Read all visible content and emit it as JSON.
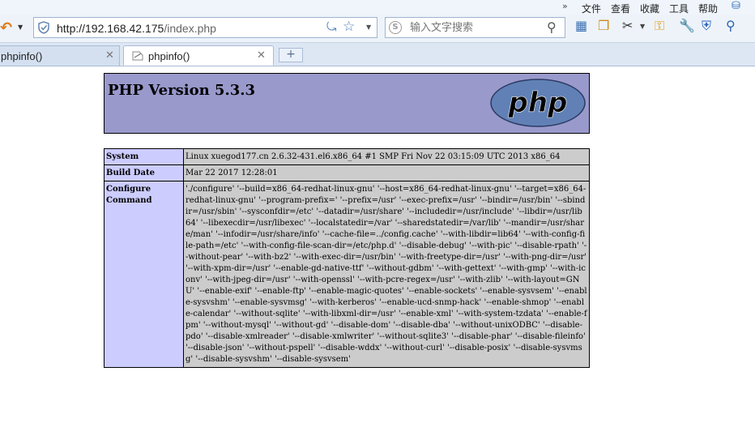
{
  "menu": {
    "chevron": "»",
    "file": "文件",
    "view": "查看",
    "favorites": "收藏",
    "tools": "工具",
    "help": "帮助"
  },
  "address_bar": {
    "url_host": "http://192.168.42.175",
    "url_path": "/index.php"
  },
  "search": {
    "placeholder": "输入文字搜索"
  },
  "toolbar_icons": [
    "calculator-icon",
    "tab-window-icon",
    "scissors-icon",
    "key-icon",
    "wrench-icon",
    "shield-check-icon",
    "magnifier-icon"
  ],
  "tabs": [
    {
      "label": "phpinfo()",
      "active": false
    },
    {
      "label": "phpinfo()",
      "active": true
    }
  ],
  "new_tab_label": "+",
  "page": {
    "header_title": "PHP Version 5.3.3",
    "logo_text": "php",
    "rows": [
      {
        "label": "System",
        "value": "Linux xuegod177.cn 2.6.32-431.el6.x86_64 #1 SMP Fri Nov 22 03:15:09 UTC 2013 x86_64"
      },
      {
        "label": "Build Date",
        "value": "Mar 22 2017 12:28:01"
      },
      {
        "label": "Configure Command",
        "value": "'./configure' '--build=x86_64-redhat-linux-gnu' '--host=x86_64-redhat-linux-gnu' '--target=x86_64-redhat-linux-gnu' '--program-prefix=' '--prefix=/usr' '--exec-prefix=/usr' '--bindir=/usr/bin' '--sbindir=/usr/sbin' '--sysconfdir=/etc' '--datadir=/usr/share' '--includedir=/usr/include' '--libdir=/usr/lib64' '--libexecdir=/usr/libexec' '--localstatedir=/var' '--sharedstatedir=/var/lib' '--mandir=/usr/share/man' '--infodir=/usr/share/info' '--cache-file=../config.cache' '--with-libdir=lib64' '--with-config-file-path=/etc' '--with-config-file-scan-dir=/etc/php.d' '--disable-debug' '--with-pic' '--disable-rpath' '--without-pear' '--with-bz2' '--with-exec-dir=/usr/bin' '--with-freetype-dir=/usr' '--with-png-dir=/usr' '--with-xpm-dir=/usr' '--enable-gd-native-ttf' '--without-gdbm' '--with-gettext' '--with-gmp' '--with-iconv' '--with-jpeg-dir=/usr' '--with-openssl' '--with-pcre-regex=/usr' '--with-zlib' '--with-layout=GNU' '--enable-exif' '--enable-ftp' '--enable-magic-quotes' '--enable-sockets' '--enable-sysvsem' '--enable-sysvshm' '--enable-sysvmsg' '--with-kerberos' '--enable-ucd-snmp-hack' '--enable-shmop' '--enable-calendar' '--without-sqlite' '--with-libxml-dir=/usr' '--enable-xml' '--with-system-tzdata' '--enable-fpm' '--without-mysql' '--without-gd' '--disable-dom' '--disable-dba' '--without-unixODBC' '--disable-pdo' '--disable-xmlreader' '--disable-xmlwriter' '--without-sqlite3' '--disable-phar' '--disable-fileinfo' '--disable-json' '--without-pspell' '--disable-wddx' '--without-curl' '--disable-posix' '--disable-sysvmsg' '--disable-sysvshm' '--disable-sysvsem'"
      }
    ]
  },
  "colors": {
    "header_bg": "#9999cc",
    "label_bg": "#ccccff",
    "value_bg": "#cccccc",
    "logo_bg": "#6181b6"
  }
}
